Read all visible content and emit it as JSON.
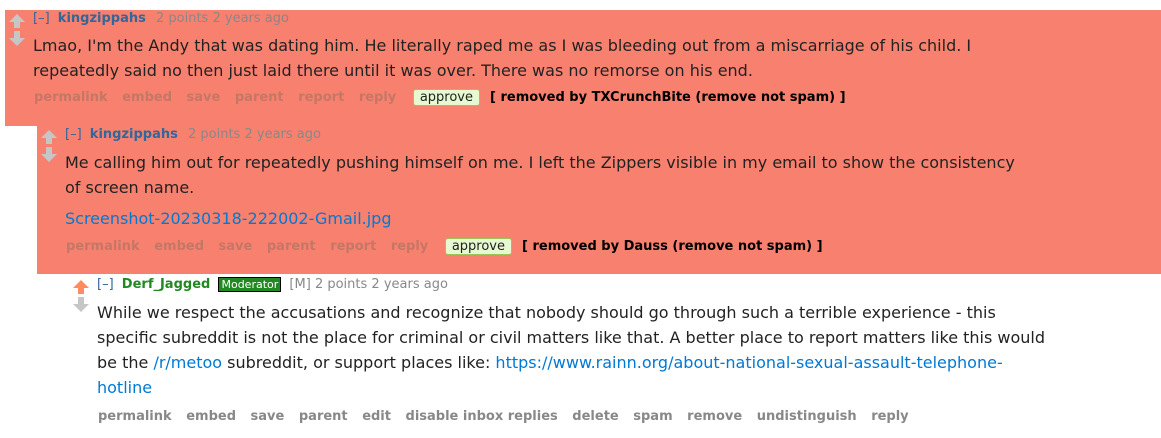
{
  "comment1": {
    "expand": "[–]",
    "author": "kingzippahs",
    "score": "2 points",
    "age": "2 years ago",
    "body_line1": "Lmao, I'm the Andy that was dating him. He literally raped me as I was bleeding out from a miscarriage of his child. I",
    "body_line2": "repeatedly said no then just laid there until it was over. There was no remorse on his end.",
    "buttons": [
      "permalink",
      "embed",
      "save",
      "parent",
      "report",
      "reply"
    ],
    "approve": "approve",
    "removed_note": "[ removed by TXCrunchBite (remove not spam) ]"
  },
  "comment2": {
    "expand": "[–]",
    "author": "kingzippahs",
    "score": "2 points",
    "age": "2 years ago",
    "body_line1": "Me calling him out for repeatedly pushing himself on me. I left the Zippers visible in my email to show the consistency",
    "body_line2": "of screen name.",
    "attachment": "Screenshot-20230318-222002-Gmail.jpg",
    "buttons": [
      "permalink",
      "embed",
      "save",
      "parent",
      "report",
      "reply"
    ],
    "approve": "approve",
    "removed_note": "[ removed by Dauss (remove not spam) ]"
  },
  "comment3": {
    "expand": "[–]",
    "author": "Derf_Jagged",
    "flair": "Moderator",
    "mflag": "[M]",
    "score": "2 points",
    "age": "2 years ago",
    "body_line1": "While we respect the accusations and recognize that nobody should go through such a terrible experience - this",
    "body_line2": "specific subreddit is not the place for criminal or civil matters like that. A better place to report matters like this would",
    "body_line3_pre": "be the ",
    "link_sub": "/r/metoo",
    "body_line3_mid": " subreddit, or support places like: ",
    "link_rainn_part1": "https://www.rainn.org/about-national-sexual-assault-telephone-",
    "link_rainn_part2": "hotline",
    "buttons": [
      "permalink",
      "embed",
      "save",
      "parent",
      "edit",
      "disable inbox replies",
      "delete",
      "spam",
      "remove",
      "undistinguish",
      "reply"
    ]
  },
  "colors": {
    "removed_bg": "#f8806f",
    "author": "#336699",
    "moderator": "#228822",
    "link": "#0079d3"
  }
}
